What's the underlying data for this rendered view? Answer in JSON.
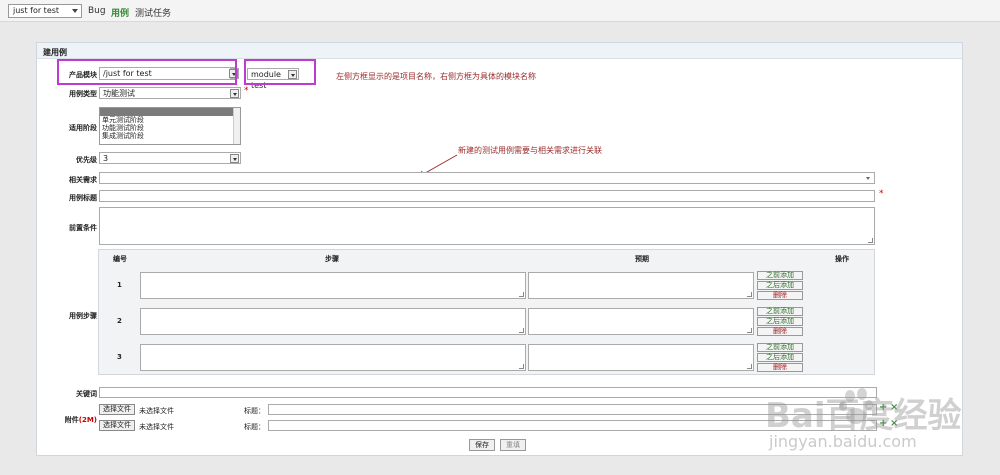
{
  "topbar": {
    "product": "just for test",
    "nav": [
      "Bug",
      "用例",
      "测试任务"
    ]
  },
  "panel": {
    "title": "建用例",
    "fields": {
      "module_label": "产品模块",
      "module_value": "/just for test",
      "module_sub_value": "module test",
      "type_label": "用例类型",
      "type_value": "功能测试",
      "stage_label": "适用阶段",
      "stage_options": [
        "",
        "单元测试阶段",
        "功能测试阶段",
        "集成测试阶段"
      ],
      "priority_label": "优先级",
      "priority_value": "3",
      "story_label": "相关需求",
      "title_label": "用例标题",
      "precondition_label": "前置条件",
      "steps_label": "用例步骤",
      "keywords_label": "关键词",
      "files_label": "附件",
      "files_limit": "(2M)",
      "required_mark": "*"
    },
    "steps": {
      "headers": [
        "编号",
        "步骤",
        "预期",
        "操作"
      ],
      "rows": [
        {
          "num": "1"
        },
        {
          "num": "2"
        },
        {
          "num": "3"
        }
      ],
      "actions": [
        "之前添加",
        "之后添加",
        "删除"
      ]
    },
    "files": {
      "choose_label": "选择文件",
      "no_file": "未选择文件",
      "title_label": "标题："
    },
    "buttons": {
      "save": "保存",
      "reset": "重填"
    }
  },
  "annotations": {
    "module_note": "左侧方框显示的是项目名称，右侧方框为具体的模块名称",
    "story_note": "新建的测试用例需要与相关需求进行关联"
  },
  "watermark": {
    "brand": "Bai百度经验",
    "url": "jingyan.baidu.com"
  },
  "colors": {
    "highlight": "#c03ad0",
    "annotation": "#9b2a2a",
    "active_nav": "#3a8a3a"
  }
}
